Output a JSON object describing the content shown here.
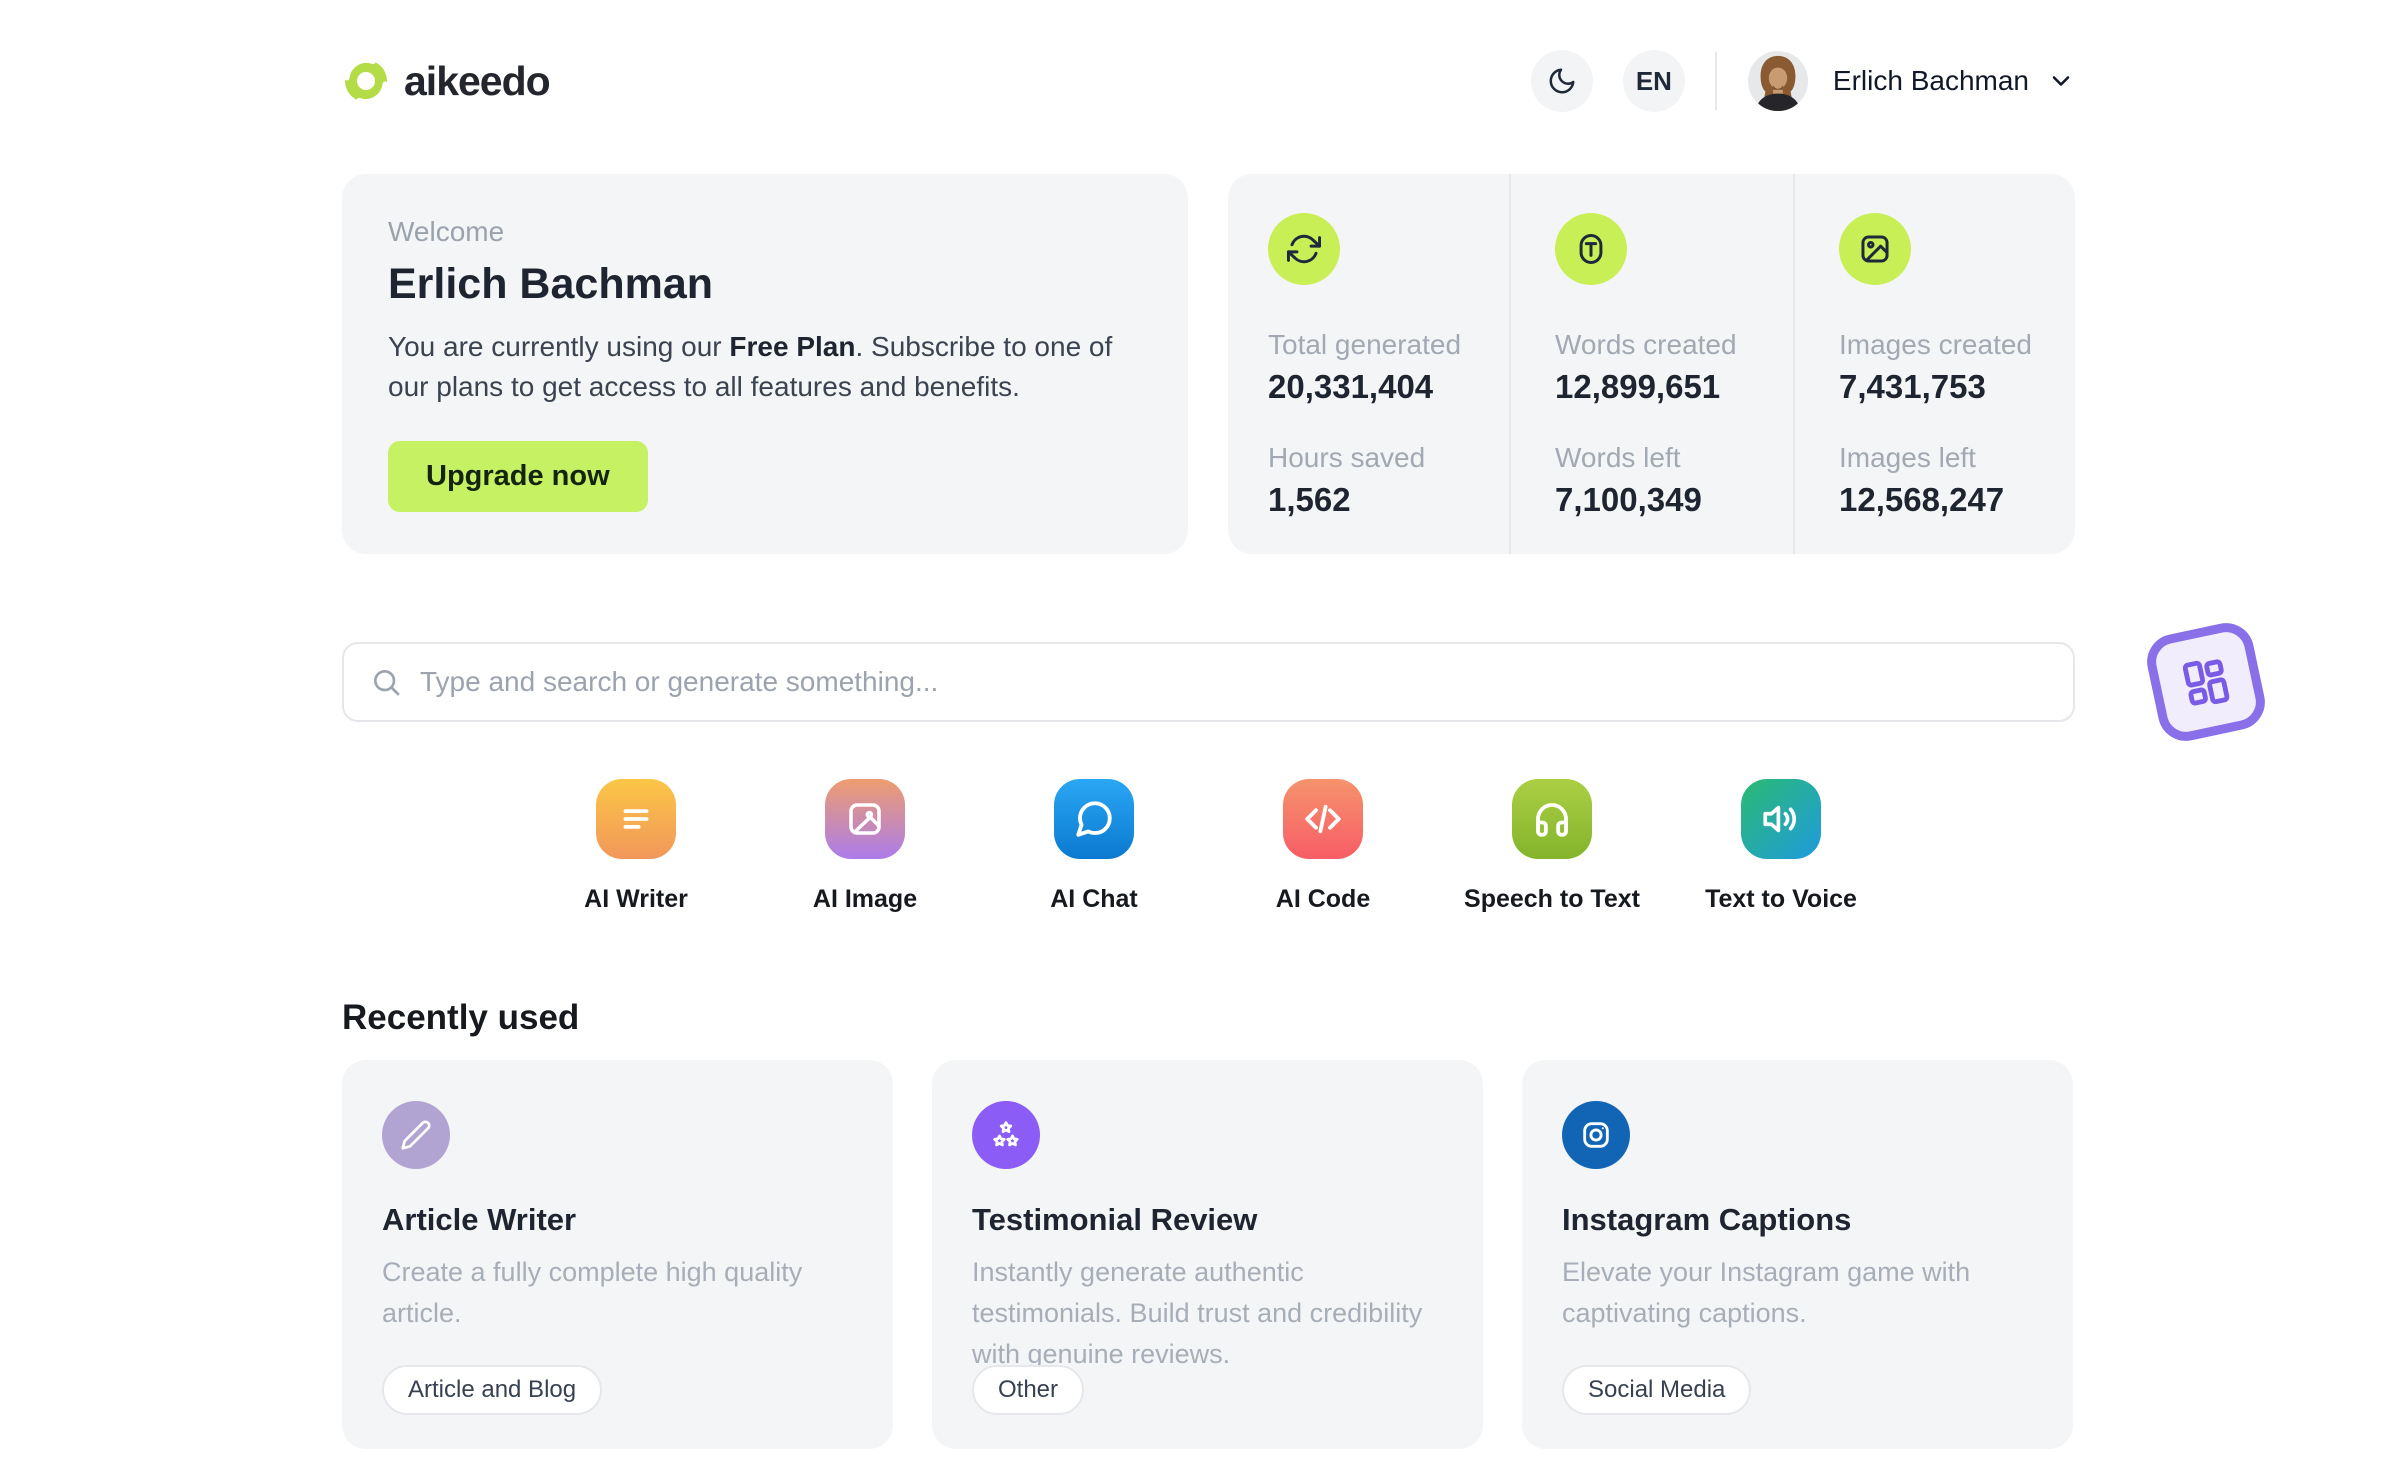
{
  "header": {
    "logo_text": "aikeedo",
    "logo_icon": "green-swirl-logo",
    "dark_mode_icon": "moon-icon",
    "language": "EN",
    "user_name": "Erlich Bachman",
    "user_menu_icon": "chevron-down-icon"
  },
  "welcome": {
    "eyebrow": "Welcome",
    "name": "Erlich Bachman",
    "plan_prefix": "You are currently using our ",
    "plan_name": "Free Plan",
    "plan_suffix": ". Subscribe to one of our plans to get access to all features and benefits.",
    "upgrade_label": "Upgrade now"
  },
  "stats": {
    "columns": [
      {
        "icon": "sync-icon",
        "top_label": "Total generated",
        "top_value": "20,331,404",
        "bottom_label": "Hours saved",
        "bottom_value": "1,562"
      },
      {
        "icon": "text-icon",
        "top_label": "Words created",
        "top_value": "12,899,651",
        "bottom_label": "Words left",
        "bottom_value": "7,100,349"
      },
      {
        "icon": "image-icon",
        "top_label": "Images created",
        "top_value": "7,431,753",
        "bottom_label": "Images left",
        "bottom_value": "12,568,247"
      }
    ]
  },
  "search": {
    "placeholder": "Type and search or generate something...",
    "icon": "search-icon"
  },
  "float_badge": {
    "icon": "apps-grid-icon"
  },
  "tools": [
    {
      "label": "AI Writer",
      "icon": "text-lines-icon",
      "gradient": [
        "#fbc646",
        "#f2975a"
      ]
    },
    {
      "label": "AI Image",
      "icon": "photo-icon",
      "gradient": [
        "#ee9d6f",
        "#ab7ce9"
      ]
    },
    {
      "label": "AI Chat",
      "icon": "chat-bubble-icon",
      "gradient": [
        "#2aa7f4",
        "#0b79d0"
      ]
    },
    {
      "label": "AI Code",
      "icon": "code-icon",
      "gradient": [
        "#f6936c",
        "#f75d66"
      ]
    },
    {
      "label": "Speech to Text",
      "icon": "headphones-icon",
      "gradient": [
        "#accf44",
        "#83b42b"
      ]
    },
    {
      "label": "Text to Voice",
      "icon": "speaker-icon",
      "gradient": [
        "#2cba72",
        "#1e9bdd"
      ]
    }
  ],
  "recent": {
    "heading": "Recently used",
    "cards": [
      {
        "title": "Article Writer",
        "description": "Create a fully complete high quality article.",
        "tag": "Article and Blog",
        "icon": "pencil-icon",
        "icon_bg": "#b2a4d2"
      },
      {
        "title": "Testimonial Review",
        "description": "Instantly generate authentic testimonials. Build trust and credibility with genuine reviews.",
        "tag": "Other",
        "icon": "stars-icon",
        "icon_bg": "#8b5cf6"
      },
      {
        "title": "Instagram Captions",
        "description": "Elevate your Instagram game with captivating captions.",
        "tag": "Social Media",
        "icon": "instagram-icon",
        "icon_bg": "#1165b4"
      }
    ]
  },
  "colors": {
    "page_bg": "#ffffff",
    "card_bg": "#f4f5f6",
    "accent_lime_button": "#c5f163",
    "accent_lime_circle": "#c8ef55",
    "badge_purple": "#8a70e8",
    "muted_text": "#9ca3af",
    "dark_text": "#1f2530"
  }
}
